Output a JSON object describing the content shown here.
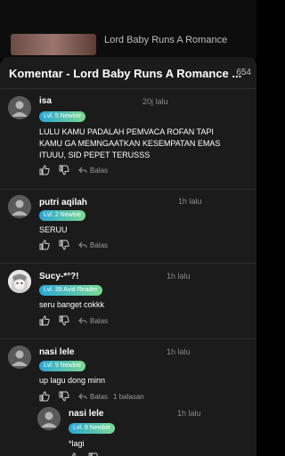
{
  "background": {
    "title": "Lord Baby Runs A Romance"
  },
  "sheet": {
    "title": "Komentar - Lord Baby Runs A Romance ...",
    "count": "654"
  },
  "reply_label": "Balas",
  "comments": [
    {
      "name": "isa",
      "time": "20j lalu",
      "badge": "Lvl. 5 Newbie",
      "text": "LULU KAMU PADALAH PEMVACA ROFAN TAPI KAMU GA MEMNGAATKAN KESEMPATAN EMAS ITUUU, SID PEPET TERUSSS"
    },
    {
      "name": "putri aqilah",
      "time": "1h lalu",
      "badge": "Lvl. 2 Newbie",
      "text": "SERUU"
    },
    {
      "name": "Sucy-*°?!",
      "time": "1h lalu",
      "badge": "Lvl. 39 Avid Reader",
      "text": "seru banget cokkk"
    },
    {
      "name": "nasi lele",
      "time": "1h lalu",
      "badge": "Lvl. 9 Newbie",
      "text": "up lagu dong minn",
      "replies_label": "1 balasan"
    }
  ],
  "reply": {
    "name": "nasi lele",
    "time": "1h lalu",
    "badge": "Lvl. 9 Newbie",
    "text": "*lagi"
  },
  "colors": {
    "badge_gradient_start": "#2aa6d6",
    "badge_gradient_end": "#7cd88e",
    "sheet_bg": "#1b1b1b"
  }
}
